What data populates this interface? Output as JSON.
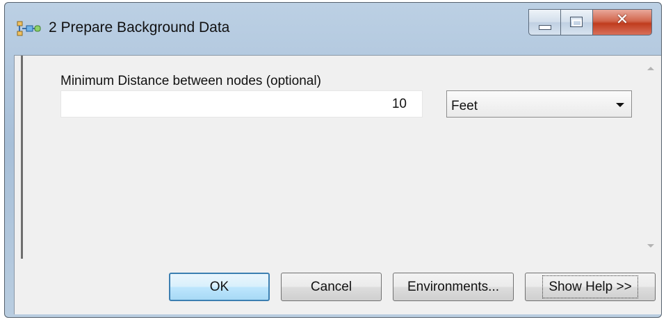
{
  "window": {
    "title": "2 Prepare Background Data",
    "icon": "model-builder-icon",
    "controls": {
      "minimize": "minimize-icon",
      "maximize": "maximize-icon",
      "close": "close-icon"
    }
  },
  "parameters": [
    {
      "label": "Minimum Distance between nodes (optional)",
      "value": "10",
      "unit": "Feet"
    }
  ],
  "buttons": {
    "ok": "OK",
    "cancel": "Cancel",
    "environments": "Environments...",
    "show_help": "Show Help >>"
  }
}
